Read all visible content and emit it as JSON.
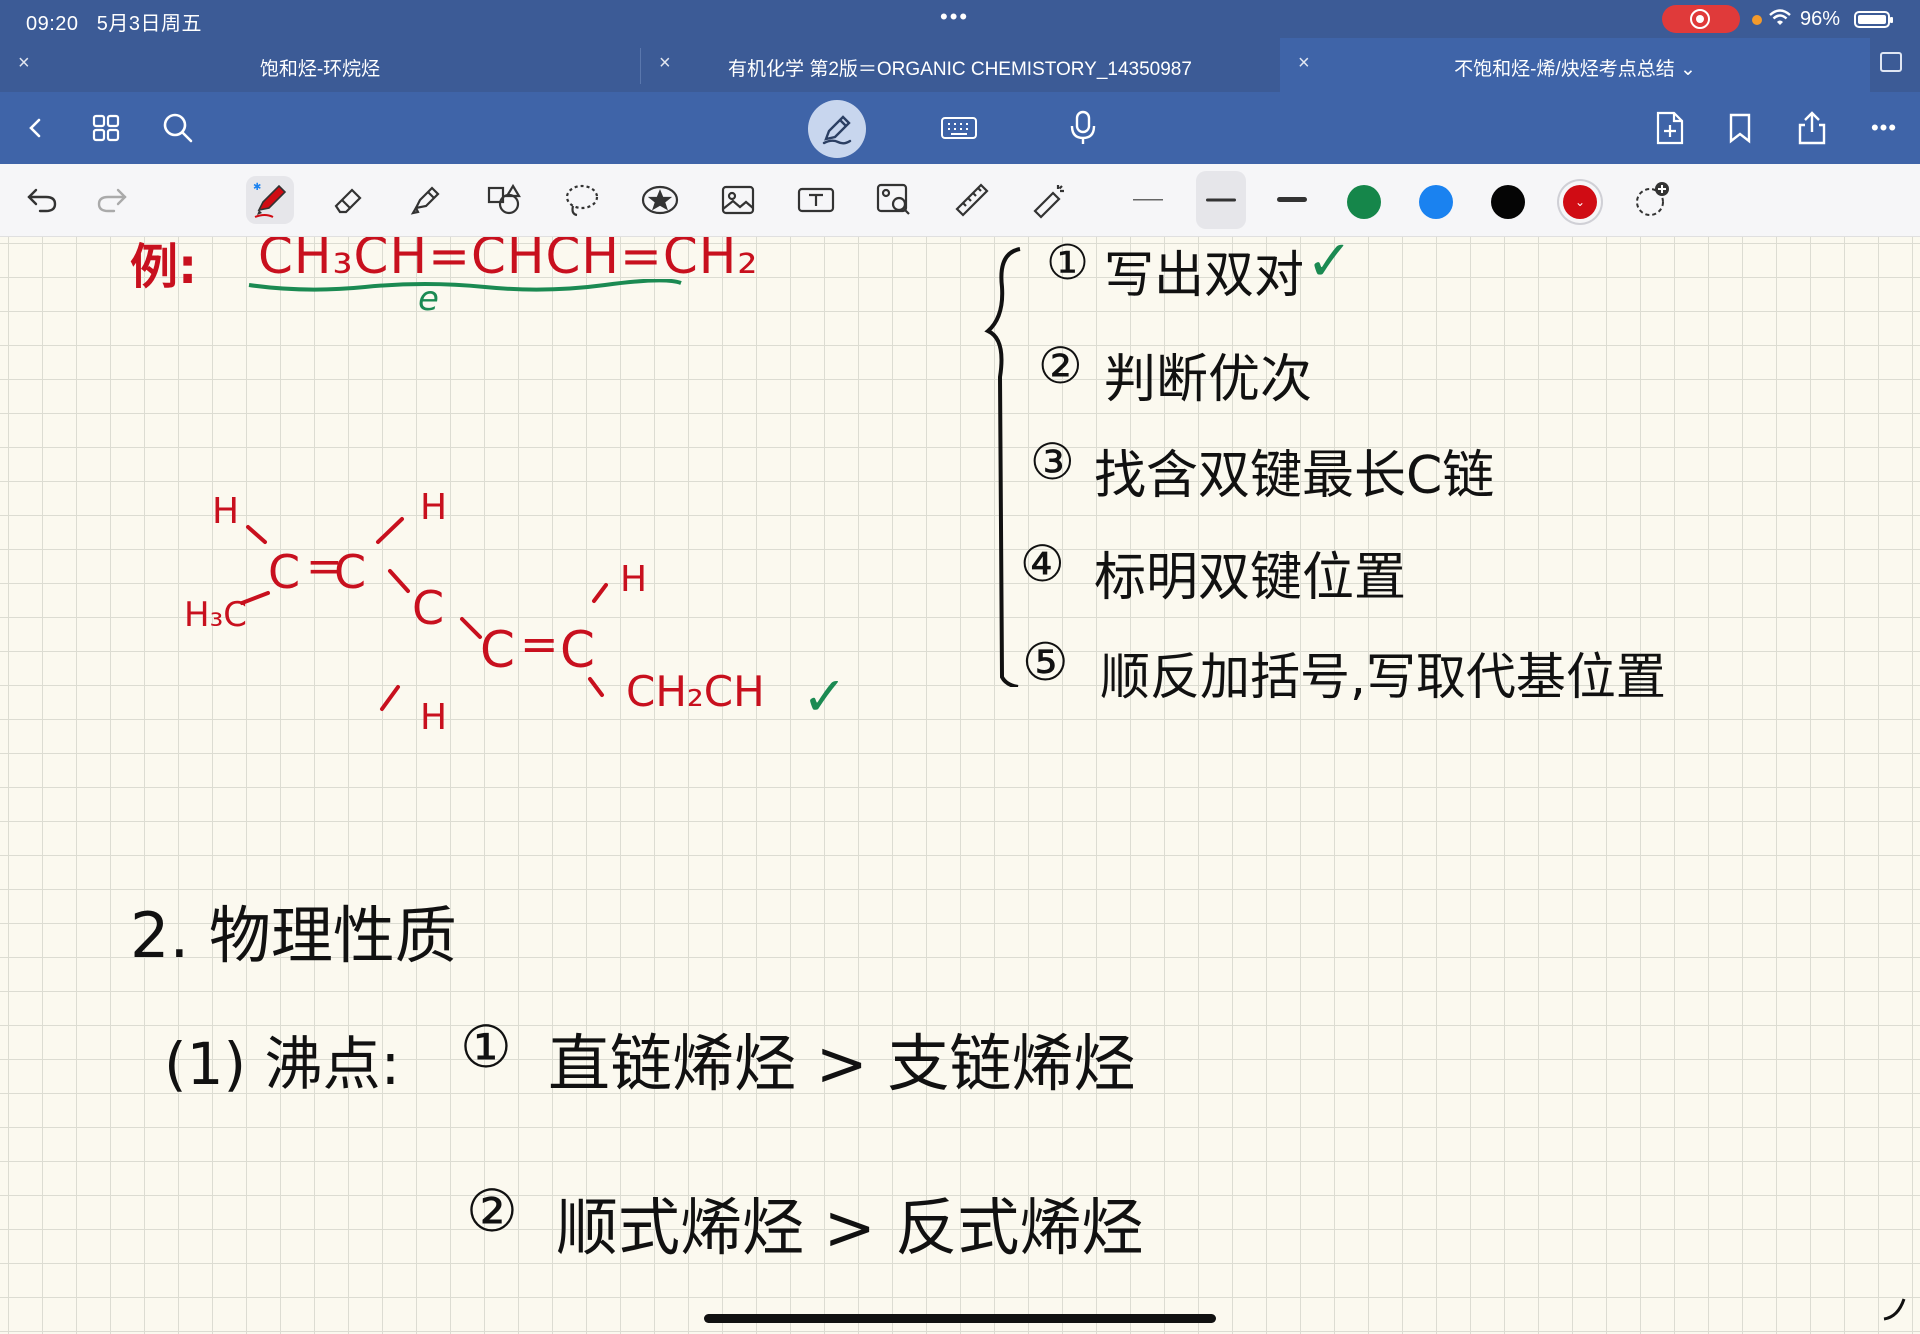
{
  "status_bar": {
    "time": "09:20",
    "date": "5月3日周五",
    "battery": "96%"
  },
  "tabs": [
    {
      "label": "饱和烃-环烷烃"
    },
    {
      "label": "有机化学  第2版＝ORGANIC CHEMISTORY_14350987"
    },
    {
      "label": "不饱和烃-烯/炔烃考点总结 ⌄"
    }
  ],
  "icons": {
    "close": "×",
    "back": "‹",
    "grid": "grid-icon",
    "search": "search-icon",
    "pen_mode": "pen-icon",
    "keyboard": "keyboard-icon",
    "mic": "microphone-icon",
    "add_page": "add-page-icon",
    "bookmark": "bookmark-icon",
    "share": "share-icon",
    "more": "•••"
  },
  "palette": {
    "colors": [
      "#15864a",
      "#1a82f0",
      "#050505",
      "#d00c14"
    ],
    "selected_color": "#d00c14"
  },
  "note": {
    "example_label": "例:",
    "example_formula": "CH₃CH=CHCH=CH₂",
    "circle_mark": "e",
    "structure": {
      "h1": "H",
      "h2": "H",
      "h3": "H",
      "h4": "H",
      "h3c": "H₃C",
      "c1": "C",
      "c2": "C",
      "c3": "C",
      "c4": "C",
      "c5": "C",
      "eq1": "=",
      "eq2": "=",
      "ch2ch": "CH₂CH"
    },
    "steps": [
      {
        "num": "①",
        "text": "写出双对"
      },
      {
        "num": "②",
        "text": "判断优次"
      },
      {
        "num": "③",
        "text": "找含双键最长C链"
      },
      {
        "num": "④",
        "text": "标明双键位置"
      },
      {
        "num": "⑤",
        "text": "顺反加括号,写取代基位置"
      }
    ],
    "check": "✓",
    "section_title": "2. 物理性质",
    "boiling_label": "(1) 沸点:",
    "bp_rule1_num": "①",
    "bp_rule1": "直链烯烃 > 支链烯烃",
    "bp_rule2_num": "②",
    "bp_rule2": "顺式烯烃 > 反式烯烃"
  }
}
